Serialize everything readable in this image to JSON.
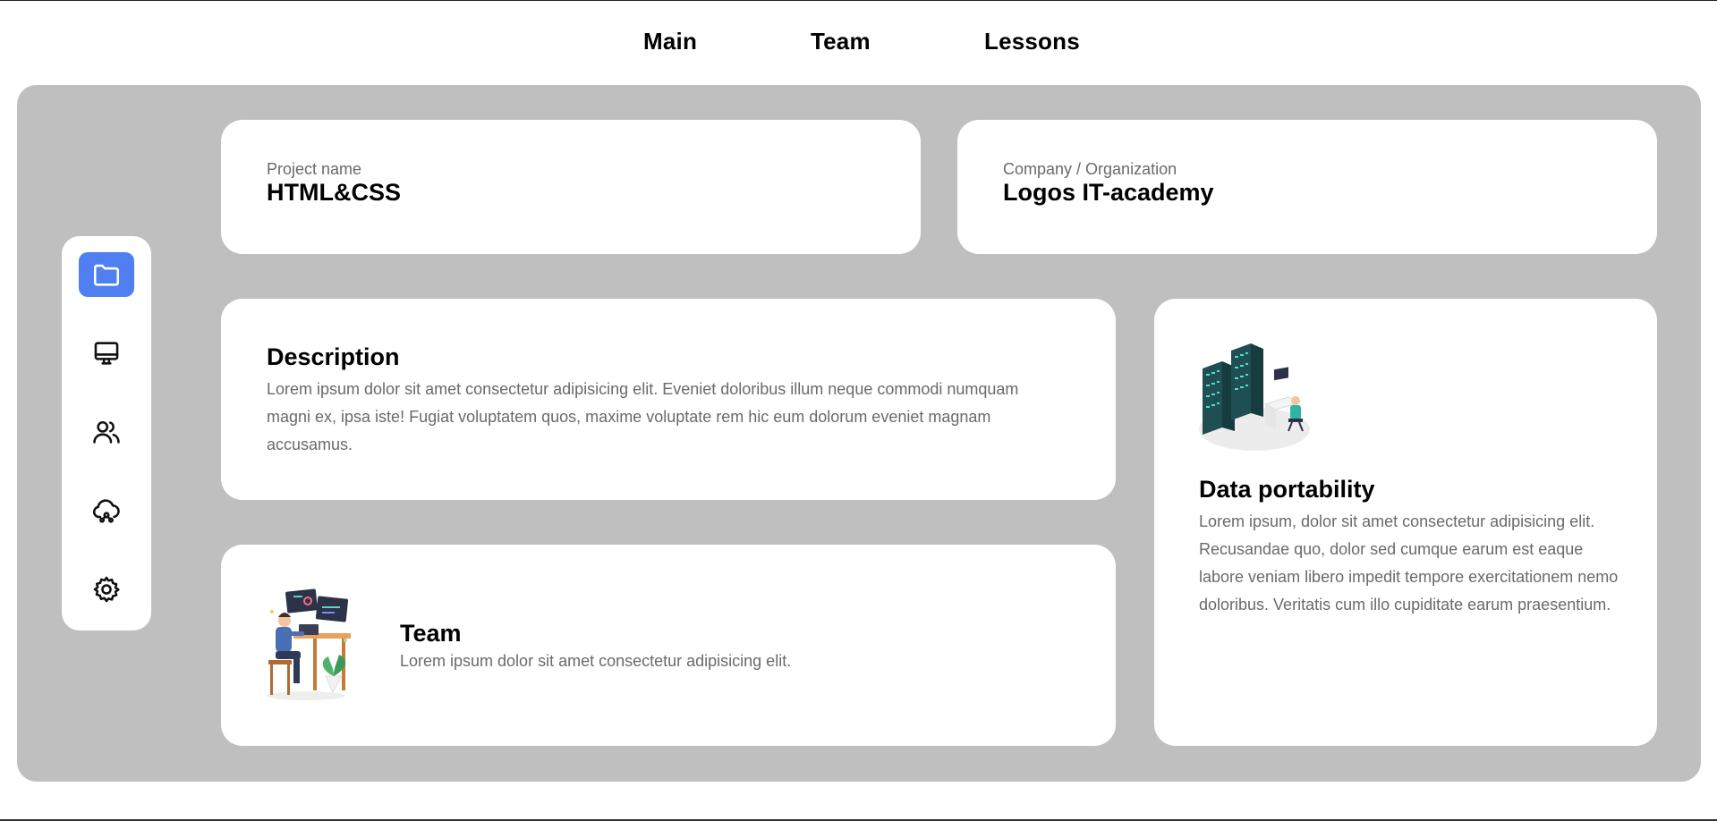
{
  "nav": {
    "items": [
      {
        "label": "Main"
      },
      {
        "label": "Team"
      },
      {
        "label": "Lessons"
      }
    ]
  },
  "sidebar": {
    "items": [
      {
        "icon": "folder-icon",
        "active": true
      },
      {
        "icon": "monitor-icon",
        "active": false
      },
      {
        "icon": "users-icon",
        "active": false
      },
      {
        "icon": "cloud-share-icon",
        "active": false
      },
      {
        "icon": "gear-icon",
        "active": false
      }
    ],
    "accent": "#4f7ff0"
  },
  "project": {
    "label": "Project name",
    "value": "HTML&CSS"
  },
  "company": {
    "label": "Company / Organization",
    "value": "Logos IT-academy"
  },
  "description": {
    "title": "Description",
    "text": "Lorem ipsum dolor sit amet consectetur adipisicing elit. Eveniet doloribus illum neque commodi numquam magni ex, ipsa iste! Fugiat voluptatem quos, maxime voluptate rem hic eum dolorum eveniet magnam accusamus."
  },
  "team": {
    "title": "Team",
    "text": "Lorem ipsum dolor sit amet consectetur adipisicing elit."
  },
  "data_portability": {
    "title": "Data portability",
    "text": "Lorem ipsum, dolor sit amet consectetur adipisicing elit. Recusandae quo, dolor sed cumque earum est eaque labore veniam libero impedit tempore exercitationem nemo doloribus. Veritatis cum illo cupiditate earum praesentium."
  },
  "colors": {
    "panel_bg": "#bfbfbf",
    "card_bg": "#ffffff",
    "muted_text": "#6a6a6a"
  }
}
